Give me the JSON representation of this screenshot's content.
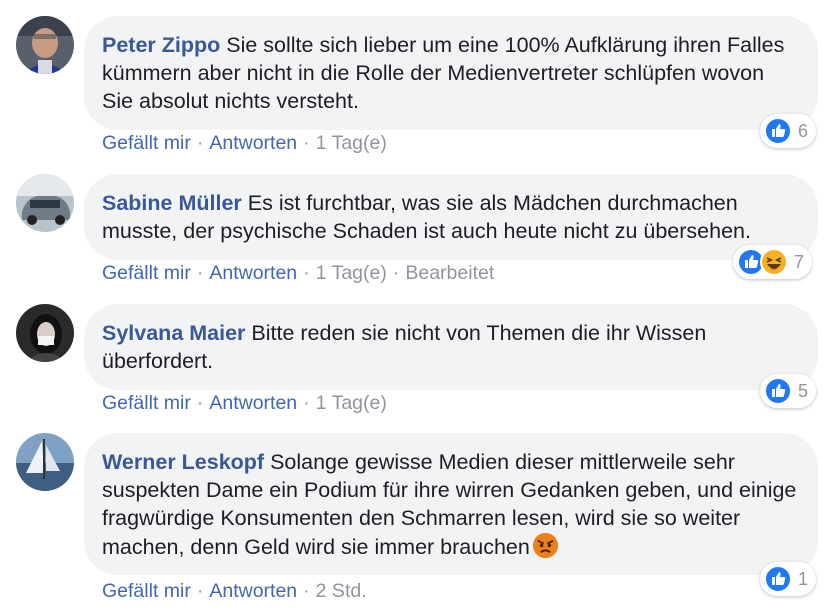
{
  "comments": [
    {
      "author": "Peter Zippo",
      "text": " Sie sollte sich lieber um eine 100% Aufklärung ihren Falles kümmern aber nicht in die Rolle der Medienvertreter schlüpfen wovon Sie absolut nichts versteht.",
      "like": "Gefällt mir",
      "reply": "Antworten",
      "time": "1 Tag(e)",
      "reaction_count": "6"
    },
    {
      "author": "Sabine Müller",
      "text": " Es ist furchtbar, was sie als Mädchen durchmachen musste, der psychische Schaden ist auch heute nicht zu übersehen.",
      "like": "Gefällt mir",
      "reply": "Antworten",
      "time": "1 Tag(e)",
      "edited": "Bearbeitet",
      "reaction_count": "7"
    },
    {
      "author": "Sylvana Maier",
      "text": " Bitte reden sie nicht von Themen die ihr Wissen überfordert.",
      "like": "Gefällt mir",
      "reply": "Antworten",
      "time": "1 Tag(e)",
      "reaction_count": "5"
    },
    {
      "author": "Werner Leskopf",
      "text": " Solange gewisse Medien dieser mittlerweile sehr suspekten Dame ein Podium für ihre wirren Gedanken geben, und einige fragwürdige Konsumenten den Schmarren lesen, wird sie so weiter machen, denn Geld wird sie immer brauchen",
      "like": "Gefällt mir",
      "reply": "Antworten",
      "time": "2 Std.",
      "reaction_count": "1"
    }
  ],
  "separator": "·",
  "colors": {
    "author": "#385898",
    "link": "#4267b2",
    "meta": "#90949c",
    "bubble": "#f2f3f5",
    "like_blue": "#2078f4",
    "haha_yellow": "#f7b125",
    "angry_red": "#e9710f"
  },
  "icons": [
    "like-icon",
    "haha-icon",
    "angry-face-emoji"
  ]
}
